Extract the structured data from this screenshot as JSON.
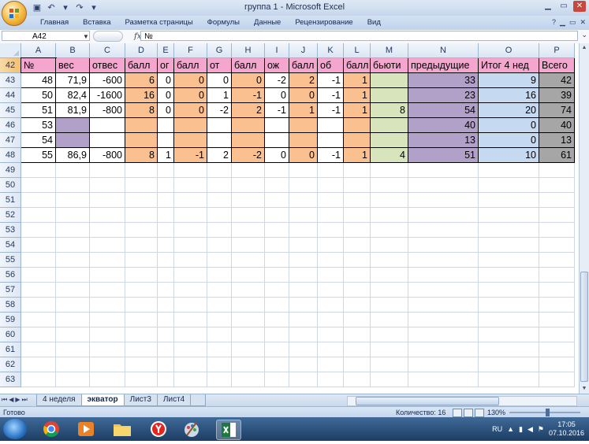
{
  "window": {
    "title": "группа 1 - Microsoft Excel",
    "ribbon_tabs": [
      "Главная",
      "Вставка",
      "Разметка страницы",
      "Формулы",
      "Данные",
      "Рецензирование",
      "Вид"
    ]
  },
  "formula_bar": {
    "name_box": "A42",
    "fx_label": "fx",
    "content": "№"
  },
  "columns": [
    "A",
    "B",
    "C",
    "D",
    "E",
    "F",
    "G",
    "H",
    "I",
    "J",
    "K",
    "L",
    "M",
    "N",
    "O",
    "P"
  ],
  "colors": {
    "header_pink": "#f4a6cf",
    "peach": "#fac090",
    "green": "#d8e4bc",
    "purple": "#b1a0c7",
    "blue": "#c5d9f1",
    "gray": "#a6a6a6",
    "white": "#ffffff"
  },
  "rows": [
    {
      "num": "42",
      "cells": [
        "№",
        "вес",
        "отвес",
        "балл",
        "ог",
        "балл",
        "от",
        "балл",
        "ож",
        "балл",
        "об",
        "балл",
        "бьюти",
        "предыдущие",
        "Итог 4 нед",
        "Всего"
      ]
    },
    {
      "num": "43",
      "cells": [
        "48",
        "71,9",
        "-600",
        "6",
        "0",
        "0",
        "0",
        "0",
        "-2",
        "2",
        "-1",
        "1",
        "",
        "33",
        "9",
        "42"
      ]
    },
    {
      "num": "44",
      "cells": [
        "50",
        "82,4",
        "-1600",
        "16",
        "0",
        "0",
        "1",
        "-1",
        "0",
        "0",
        "-1",
        "1",
        "",
        "23",
        "16",
        "39"
      ]
    },
    {
      "num": "45",
      "cells": [
        "51",
        "81,9",
        "-800",
        "8",
        "0",
        "0",
        "-2",
        "2",
        "-1",
        "1",
        "-1",
        "1",
        "8",
        "54",
        "20",
        "74"
      ]
    },
    {
      "num": "46",
      "cells": [
        "53",
        "",
        "",
        "",
        "",
        "",
        "",
        "",
        "",
        "",
        "",
        "",
        "",
        "40",
        "0",
        "40"
      ]
    },
    {
      "num": "47",
      "cells": [
        "54",
        "",
        "",
        "",
        "",
        "",
        "",
        "",
        "",
        "",
        "",
        "",
        "",
        "13",
        "0",
        "13"
      ]
    },
    {
      "num": "48",
      "cells": [
        "55",
        "86,9",
        "-800",
        "8",
        "1",
        "-1",
        "2",
        "-2",
        "0",
        "0",
        "-1",
        "1",
        "4",
        "51",
        "10",
        "61"
      ]
    }
  ],
  "empty_rows": [
    "49",
    "50",
    "51",
    "52",
    "53",
    "54",
    "55",
    "56",
    "57",
    "58",
    "59",
    "60",
    "61",
    "62",
    "63"
  ],
  "sheet_tabs": [
    "4 неделя",
    "экватор",
    "Лист3",
    "Лист4"
  ],
  "active_sheet": "экватор",
  "status": {
    "ready": "Готово",
    "count": "Количество: 16",
    "zoom": "130%"
  },
  "taskbar": {
    "lang": "RU",
    "time": "17:05",
    "date": "07.10.2016"
  }
}
